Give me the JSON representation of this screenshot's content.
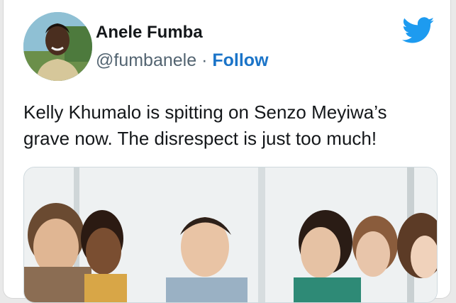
{
  "tweet": {
    "author_name": "Anele Fumba",
    "handle": "@fumbanele",
    "separator": "·",
    "follow_label": "Follow",
    "text": "Kelly Khumalo is spitting on Senzo Meyiwa’s grave now. The disrespect is just too much!"
  },
  "icons": {
    "brand": "twitter-bird-icon"
  },
  "colors": {
    "brand_blue": "#1d9bf0",
    "follow_blue": "#1b74c8",
    "text_dark": "#14171a",
    "text_gray": "#536471"
  }
}
